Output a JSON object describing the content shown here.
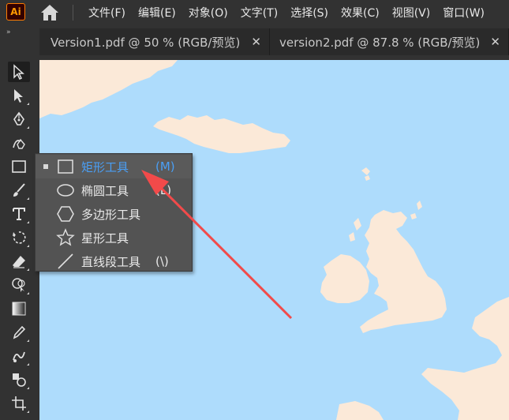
{
  "app": {
    "logo_text": "Ai"
  },
  "menu": [
    "文件(F)",
    "编辑(E)",
    "对象(O)",
    "文字(T)",
    "选择(S)",
    "效果(C)",
    "视图(V)",
    "窗口(W)"
  ],
  "tabs": [
    {
      "label": "Version1.pdf @ 50 % (RGB/预览)",
      "close": "✕"
    },
    {
      "label": "version2.pdf @ 87.8 % (RGB/预览)",
      "close": "✕"
    }
  ],
  "panel_toggle": "»",
  "flyout": {
    "items": [
      {
        "label": "矩形工具",
        "shortcut": "(M)",
        "icon": "rectangle-icon",
        "selected": true
      },
      {
        "label": "椭圆工具",
        "shortcut": "(L)",
        "icon": "ellipse-icon",
        "selected": false
      },
      {
        "label": "多边形工具",
        "shortcut": "",
        "icon": "polygon-icon",
        "selected": false
      },
      {
        "label": "星形工具",
        "shortcut": "",
        "icon": "star-icon",
        "selected": false
      },
      {
        "label": "直线段工具",
        "shortcut": "(\\)",
        "icon": "line-icon",
        "selected": false
      }
    ]
  },
  "tools": [
    "selection-icon",
    "direct-selection-icon",
    "pen-icon",
    "curvature-icon",
    "rectangle-icon",
    "paintbrush-icon",
    "type-icon",
    "rotate-icon",
    "eraser-icon",
    "shape-builder-icon",
    "gradient-icon",
    "eyedropper-icon",
    "blend-icon",
    "symbol-sprayer-icon",
    "artboard-icon"
  ],
  "colors": {
    "sea": "#aedcfc",
    "land": "#fbe9d8",
    "accent": "#4a9ff5",
    "annotation_arrow": "#f24a4a"
  }
}
